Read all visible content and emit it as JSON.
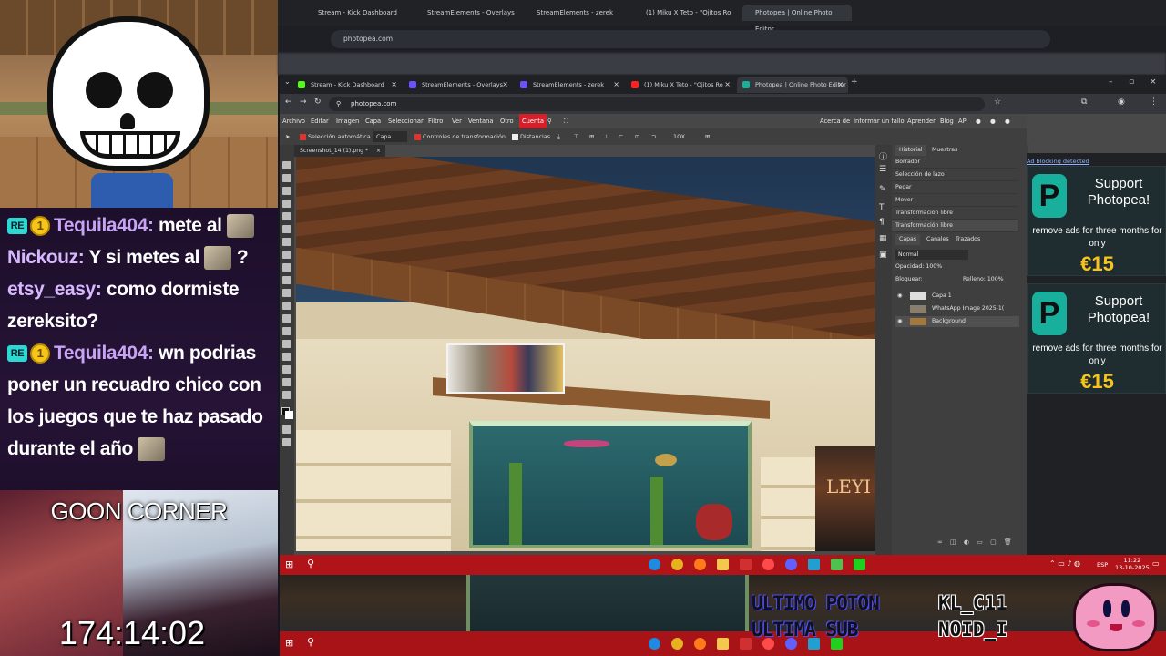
{
  "top_browser": {
    "tabs": [
      "Stream - Kick Dashboard",
      "StreamElements - Overlays",
      "StreamElements - zerek",
      "(1) Miku X Teto - \"Ojitos Ro",
      "Photopea | Online Photo Editor"
    ],
    "url": "photopea.com"
  },
  "browser": {
    "tabs": [
      {
        "label": "Stream - Kick Dashboard",
        "color": "#53fc18"
      },
      {
        "label": "StreamElements - Overlays",
        "color": "#6a52ff"
      },
      {
        "label": "StreamElements - zerek",
        "color": "#6a52ff"
      },
      {
        "label": "(1) Miku X Teto - \"Ojitos Ro",
        "color": "#ff2020"
      },
      {
        "label": "Photopea | Online Photo Editor",
        "color": "#18b09c"
      }
    ],
    "new_tab": "+",
    "url": "photopea.com"
  },
  "photopea": {
    "menu": [
      "Archivo",
      "Editar",
      "Imagen",
      "Capa",
      "Seleccionar",
      "Filtro",
      "Ver",
      "Ventana",
      "Otro",
      "Cuenta"
    ],
    "right_menu": [
      "Acerca de",
      "Informar un fallo",
      "Aprender",
      "Blog",
      "API"
    ],
    "options": {
      "auto_select": "Selección automática",
      "auto_select_mode": "Capa",
      "transform_controls": "Controles de transformación",
      "distances": "Distancias",
      "zoom_mode": "1OX"
    },
    "doc_tab": "Screenshot_14 (1).png *",
    "doc_close": "×",
    "history_tab": "Historial",
    "swatches_tab": "Muestras",
    "history": [
      "Borrador",
      "Selección de lazo",
      "Pegar",
      "Mover",
      "Transformación libre",
      "Transformación libre"
    ],
    "layers_tabs": [
      "Capas",
      "Canales",
      "Trazados"
    ],
    "blend_mode": "Normal",
    "opacity_label": "Opacidad:",
    "opacity_value": "100%",
    "lock_label": "Bloquear:",
    "fill_label": "Relleno:",
    "fill_value": "100%",
    "layers": [
      "Capa 1",
      "WhatsApp Image 2025-1(",
      "Background"
    ],
    "poster_text": "LEYI"
  },
  "ads": {
    "notice": "Ad blocking detected",
    "items": [
      {
        "title": "Support Photopea!",
        "subtitle": "remove ads for three months for only",
        "price": "€15"
      },
      {
        "title": "Support Photopea!",
        "subtitle": "remove ads for three months for only",
        "price": "€15"
      }
    ]
  },
  "chat": [
    {
      "user": "Tequila404:",
      "text": "mete al",
      "badges": true
    },
    {
      "user": "Nickouz:",
      "text": "Y si metes al",
      "after": "?",
      "badges": false
    },
    {
      "user": "etsy_easy:",
      "text": "como dormiste zereksito?",
      "badges": false
    },
    {
      "user": "Tequila404:",
      "text": "wn podrias poner un recuadro chico con los juegos que te haz pasado durante el año",
      "badges": true
    }
  ],
  "badge_label": "RE",
  "coin_label": "1",
  "goon_title": "GOON CORNER",
  "timer": "174:14:02",
  "taskbar": {
    "lang": "ESP",
    "time": "11:22",
    "date": "13-10-2025"
  },
  "alerts": {
    "line1": "ULTIMO POTON",
    "line2": "ULTIMA SUB",
    "name1": "KL_C11",
    "name2": "NOID_I"
  },
  "colors": {
    "accent_red": "#d5202b",
    "taskbar_red": "#b01419",
    "photopea_teal": "#18b09c",
    "price_yellow": "#f7c519",
    "chat_user": "#c8a4f5"
  }
}
